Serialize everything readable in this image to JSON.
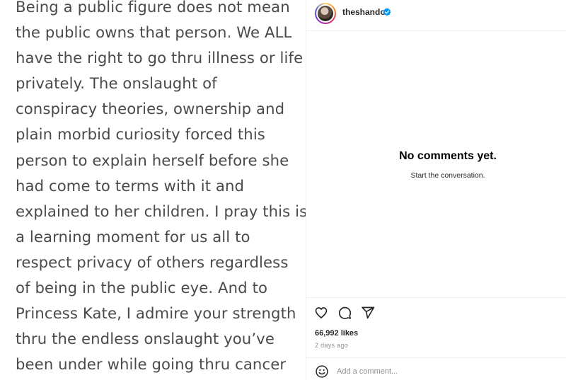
{
  "post": {
    "lines": [
      "Being a public figure does not mean",
      "the public owns that person. We ALL",
      "have the right to go thru illness or life",
      "privately.  The onslaught of",
      "conspiracy theories, ownership and",
      "plain morbid curiosity forced this",
      "person to explain herself before she",
      "had come to terms with it and",
      "explained to her children. I pray this is",
      "a learning moment for us all to",
      "respect privacy of others regardless",
      "of being in the public eye. And to",
      "Princess Kate, I admire your strength",
      "thru the endless onslaught you’ve",
      "been under while going thru cancer"
    ]
  },
  "header": {
    "username": "theshando",
    "verified_icon": "verified-badge-icon",
    "avatar_icon": "profile-avatar"
  },
  "comments": {
    "empty_title": "No comments yet.",
    "empty_subtitle": "Start the conversation."
  },
  "actions": {
    "icons": [
      "heart-icon",
      "comment-icon",
      "share-icon"
    ],
    "likes": "66,992 likes",
    "timestamp": "2 days ago"
  },
  "composer": {
    "emoji_icon": "emoji-icon",
    "placeholder": "Add a comment..."
  },
  "colors": {
    "verified_blue": "#0095f6",
    "post_text": "#4a4a4a",
    "muted": "#8e8e8e"
  }
}
